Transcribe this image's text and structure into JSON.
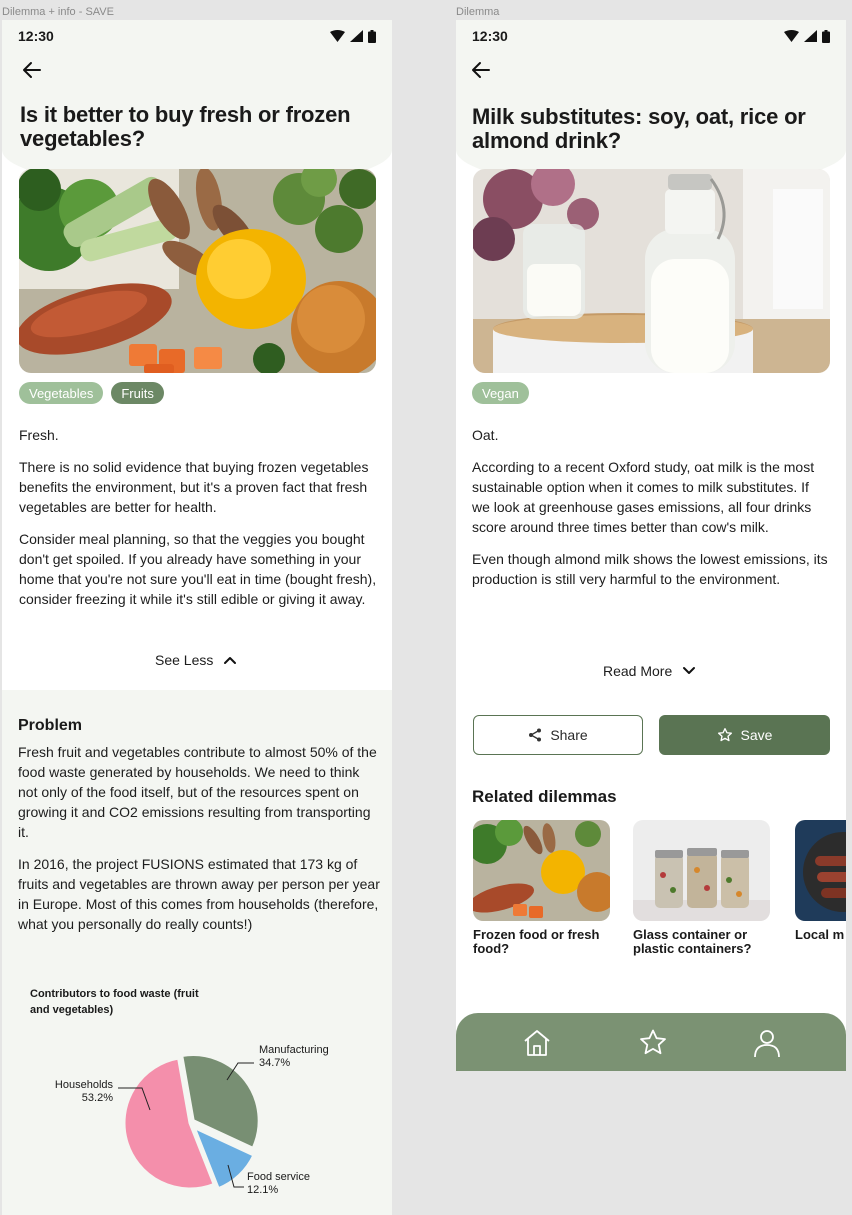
{
  "frames": {
    "left_label": "Dilemma + info - SAVE",
    "right_label": "Dilemma"
  },
  "left": {
    "status_time": "12:30",
    "title": "Is it better to buy fresh or frozen vegetables?",
    "hero_icon": "vegetables-photo",
    "tags": [
      "Vegetables",
      "Fruits"
    ],
    "answer": "Fresh.",
    "paragraphs": [
      "There is no solid evidence that buying frozen vegetables benefits the environment, but it's a proven fact that fresh vegetables are better for health.",
      "Consider meal planning, so that the veggies you bought don't get spoiled. If you already have something in your home that you're not sure you'll eat in time (bought fresh), consider freezing it while it's still edible or giving it away."
    ],
    "see_less_label": "See Less",
    "problem": {
      "heading": "Problem",
      "paragraphs": [
        "Fresh fruit and vegetables contribute to almost 50% of the food waste generated by households. We need to think not only of the food itself, but of the resources spent on growing it and CO2 emissions resulting from transporting it.",
        "In 2016, the project FUSIONS estimated that 173 kg of fruits and vegetables are thrown away per person per year in Europe. Most of this comes from households (therefore, what you personally do really counts!)"
      ]
    }
  },
  "chart_data": {
    "type": "pie",
    "title": "Contributors to food waste (fruit and vegetables)",
    "slices": [
      {
        "label": "Households",
        "value": 53.2,
        "display": "53.2%",
        "color": "#f48fab"
      },
      {
        "label": "Manufacturing",
        "value": 34.7,
        "display": "34.7%",
        "color": "#788f73"
      },
      {
        "label": "Food service",
        "value": 12.1,
        "display": "12.1%",
        "color": "#6aaee2"
      }
    ]
  },
  "right": {
    "status_time": "12:30",
    "title": "Milk substitutes: soy, oat, rice or almond drink?",
    "hero_icon": "milk-photo",
    "tags": [
      "Vegan"
    ],
    "answer": "Oat.",
    "paragraphs": [
      "According to a recent Oxford study, oat milk is the most sustainable option when it comes to milk substitutes. If we look at greenhouse gases emissions, all four drinks score around three times better than cow's milk.",
      "Even though almond milk shows the lowest emissions, its production is still very harmful to the environment."
    ],
    "read_more_label": "Read More",
    "share_label": "Share",
    "save_label": "Save",
    "related_heading": "Related dilemmas",
    "related": [
      {
        "title": "Frozen food or fresh food?"
      },
      {
        "title": "Glass container or plastic containers?"
      },
      {
        "title": "Local m alternat"
      }
    ],
    "nav": [
      "home-icon",
      "star-icon",
      "profile-icon"
    ]
  },
  "colors": {
    "accent": "#5a7453",
    "tag_light": "#9fc09a",
    "tag_dark": "#6c8865",
    "nav_bg": "#7b9273"
  }
}
